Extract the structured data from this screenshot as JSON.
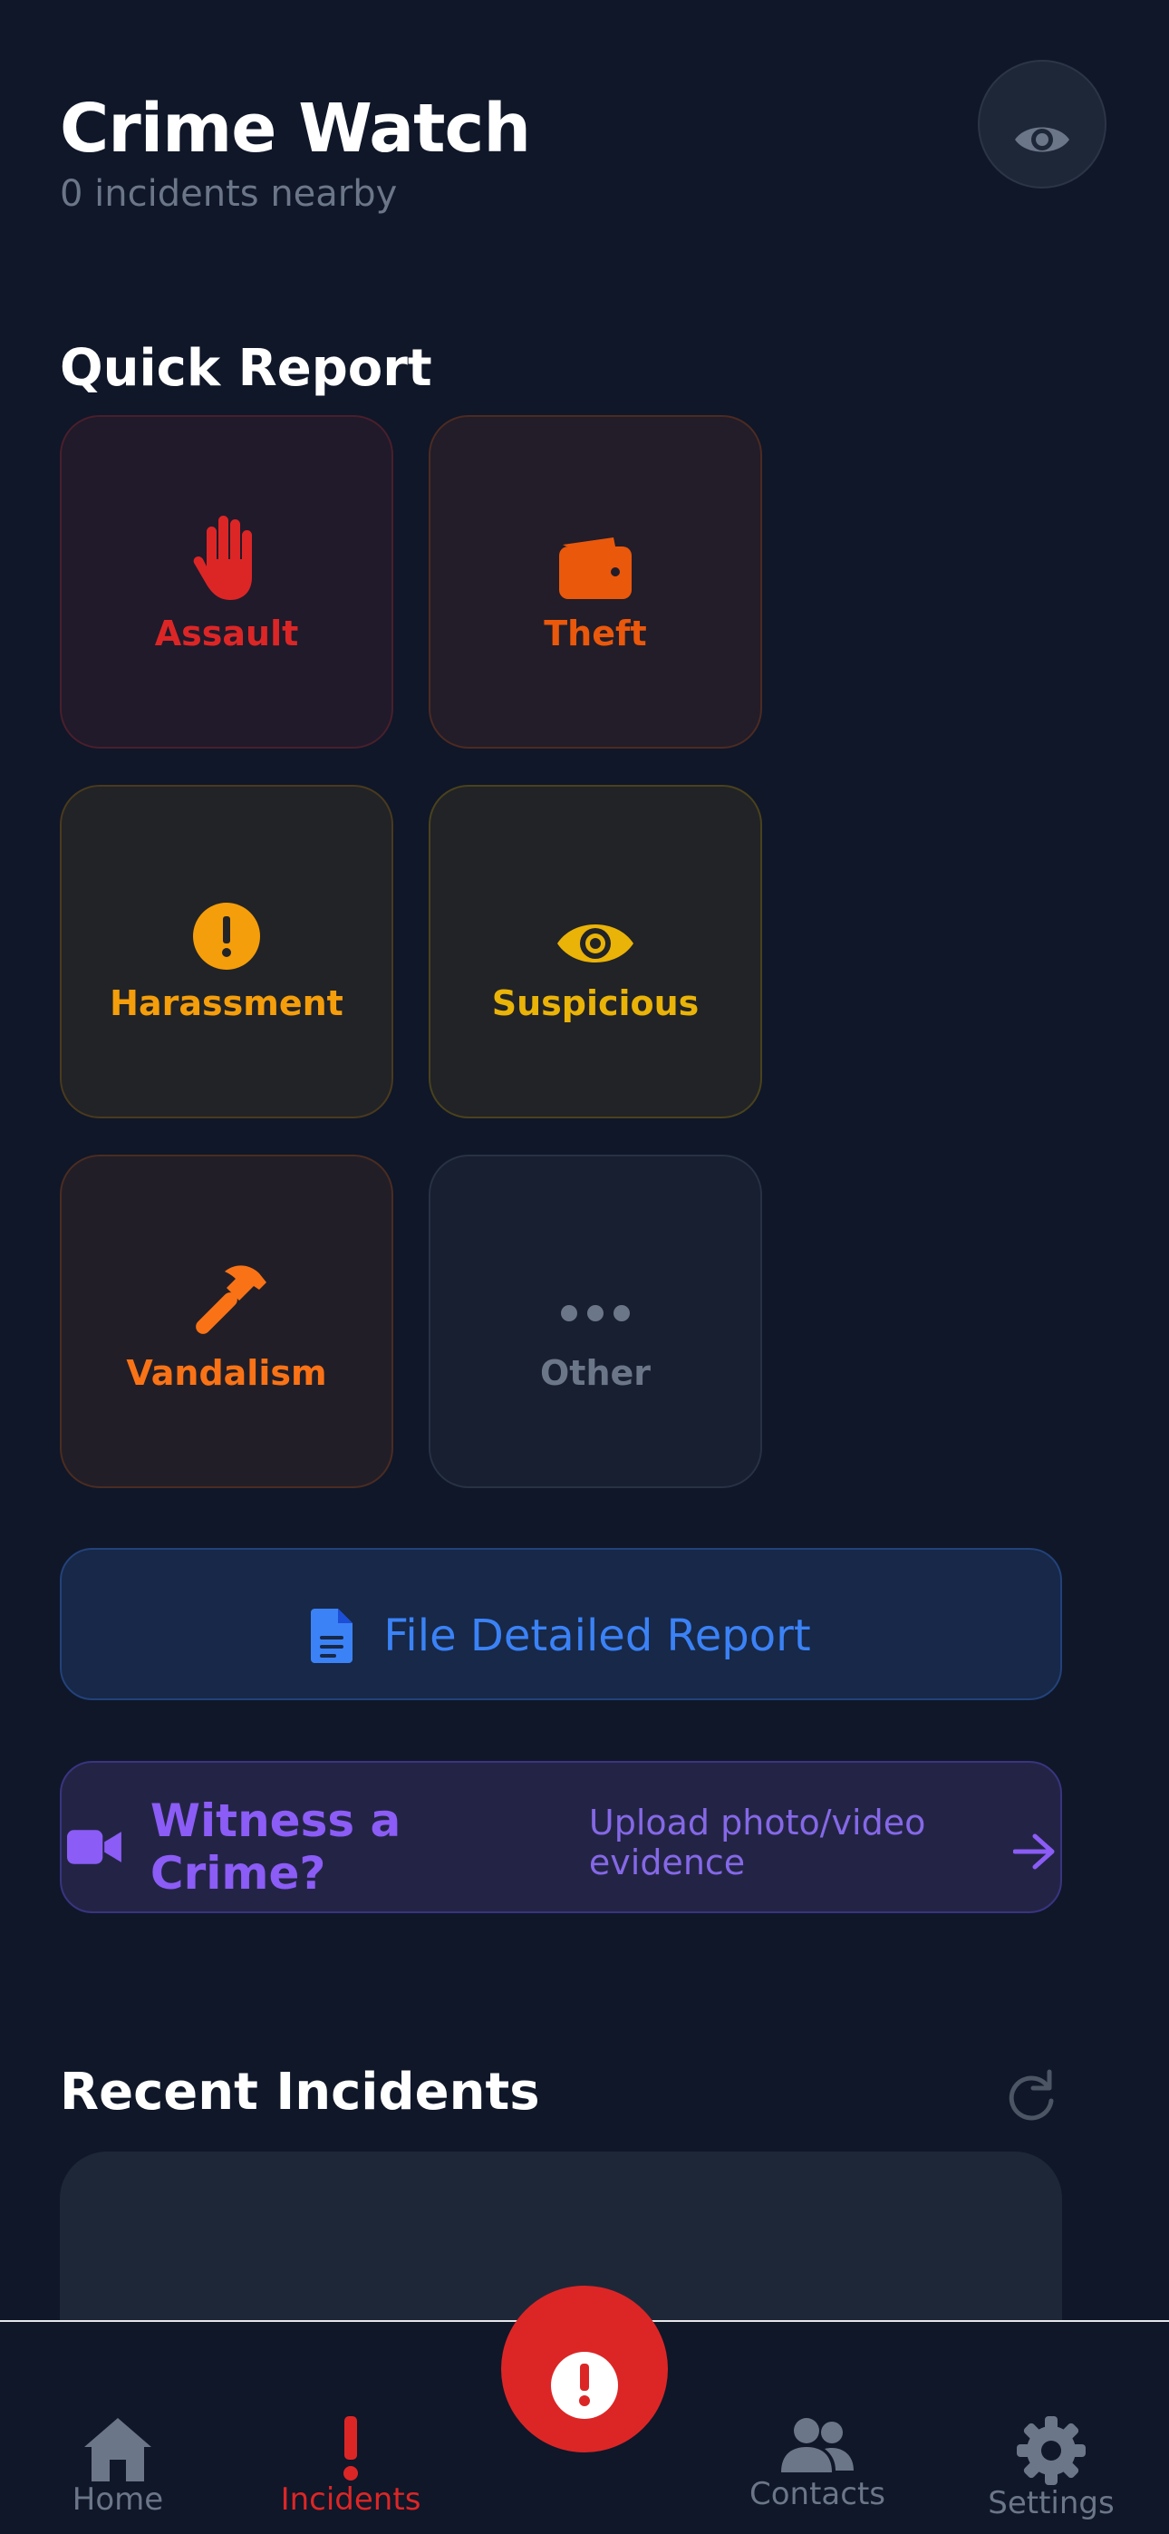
{
  "header": {
    "title": "Crime Watch",
    "subtitle": "0 incidents nearby",
    "eye_icon": "eye-icon"
  },
  "quick_report": {
    "title": "Quick Report",
    "tiles": [
      {
        "label": "Assault",
        "icon": "hand-icon",
        "color": "#dc2626"
      },
      {
        "label": "Theft",
        "icon": "wallet-icon",
        "color": "#ea580c"
      },
      {
        "label": "Harassment",
        "icon": "exclamation-circle-icon",
        "color": "#f59e0b"
      },
      {
        "label": "Suspicious",
        "icon": "eye-icon",
        "color": "#eab308"
      },
      {
        "label": "Vandalism",
        "icon": "hammer-icon",
        "color": "#f97316"
      },
      {
        "label": "Other",
        "icon": "ellipsis-icon",
        "color": "#6b7689"
      }
    ]
  },
  "detailed_report": {
    "label": "File Detailed Report",
    "icon": "document-icon",
    "color": "#3b82f6"
  },
  "witness": {
    "title": "Witness a Crime?",
    "subtitle": "Upload photo/video evidence",
    "icon": "video-camera-icon",
    "arrow_icon": "arrow-right-icon",
    "color": "#8b5cf6"
  },
  "recent": {
    "title": "Recent Incidents",
    "refresh_icon": "refresh-icon"
  },
  "nav": {
    "items": [
      {
        "label": "Home",
        "icon": "home-icon"
      },
      {
        "label": "Incidents",
        "icon": "exclamation-icon"
      },
      {
        "label": "Contacts",
        "icon": "users-icon"
      },
      {
        "label": "Settings",
        "icon": "gear-icon"
      }
    ],
    "sos_icon": "alert-icon",
    "active_color": "#dc2626"
  }
}
